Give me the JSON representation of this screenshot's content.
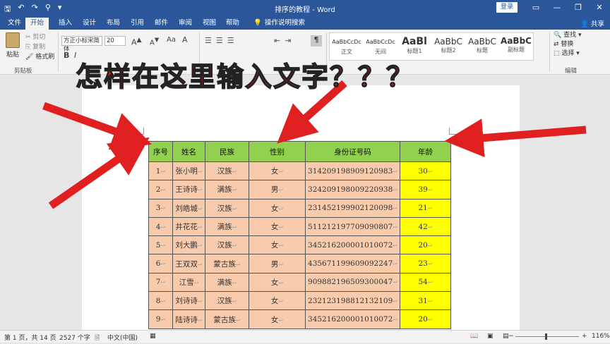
{
  "window": {
    "title": "排序的教程 - Word",
    "login_label": "登录",
    "share_label": "共享"
  },
  "tabs": [
    "文件",
    "开始",
    "插入",
    "设计",
    "布局",
    "引用",
    "邮件",
    "审阅",
    "视图",
    "帮助"
  ],
  "tell_me": "操作说明搜索",
  "ribbon": {
    "paste_label": "粘贴",
    "cut_label": "剪切",
    "copy_label": "复制",
    "format_painter_label": "格式刷",
    "clipboard_group": "剪贴板",
    "font_name": "方正小标宋简体",
    "font_size": "20",
    "styles": [
      "AaBbCcDc",
      "AaBbCcDc",
      "AaBl",
      "AaBbC",
      "AaBbC",
      "AaBbC"
    ],
    "style_names": [
      "正文",
      "无间",
      "标题1",
      "标题2",
      "标题",
      "副标题"
    ],
    "find_label": "查找",
    "replace_label": "替换",
    "select_label": "选择",
    "editing_group": "编辑"
  },
  "overlay": {
    "headline": "怎样在这里输入文字？？？"
  },
  "table": {
    "headers": [
      "序号",
      "姓名",
      "民族",
      "性别",
      "身份证号码",
      "年龄"
    ],
    "rows": [
      [
        "1",
        "张小明",
        "汉族",
        "女",
        "314209198909120983",
        "30"
      ],
      [
        "2",
        "王诗诗",
        "满族",
        "男",
        "324209198009220938",
        "39"
      ],
      [
        "3",
        "刘皓城",
        "汉族",
        "女",
        "231452199902120098",
        "21"
      ],
      [
        "4",
        "井花花",
        "满族",
        "女",
        "511212197709090807",
        "42"
      ],
      [
        "5",
        "刘大鹏",
        "汉族",
        "女",
        "345216200001010072",
        "20"
      ],
      [
        "6",
        "王双双",
        "蒙古族",
        "男",
        "435671199609092247",
        "23"
      ],
      [
        "7",
        "江雪",
        "满族",
        "女",
        "909882196509300047",
        "54"
      ],
      [
        "8",
        "刘诗诗",
        "汉族",
        "女",
        "232123198812132109",
        "31"
      ],
      [
        "9",
        "陆诗诗",
        "蒙古族",
        "女",
        "345216200001010072",
        "20"
      ]
    ]
  },
  "status": {
    "page": "第 1 页，共 14 页",
    "words": "2527 个字",
    "language": "中文(中国)",
    "zoom": "116%"
  },
  "colors": {
    "title_bar": "#2b579a",
    "header_fill": "#92d050",
    "cell_fill": "#f8cbad",
    "age_fill": "#ffff00",
    "annotation_red": "#e02020"
  }
}
